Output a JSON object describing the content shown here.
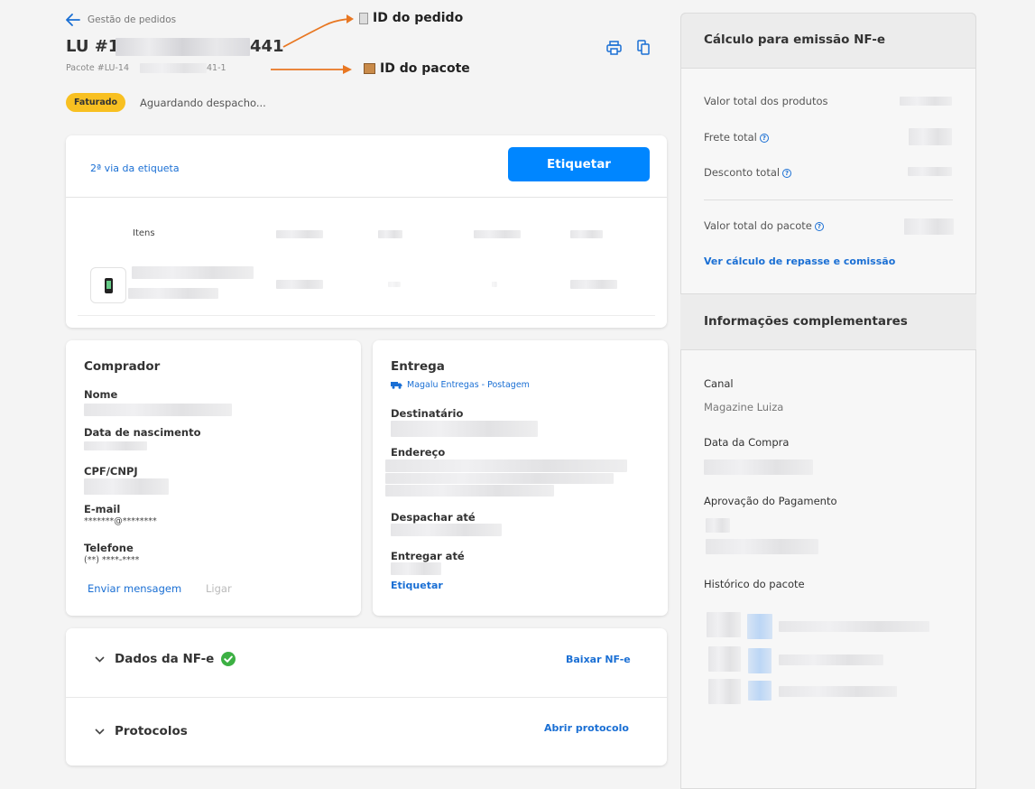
{
  "header": {
    "back_label": "Gestão de pedidos",
    "order_prefix": "LU #1",
    "order_suffix": "441",
    "package_prefix": "Pacote #LU-14",
    "package_suffix": "41-1",
    "status_badge": "Faturado",
    "status_text": "Aguardando despacho..."
  },
  "annotations": {
    "order_id": "ID do pedido",
    "package_id": "ID do pacote",
    "arrow_color": "#e87722"
  },
  "label_card": {
    "second_copy_link": "2ª via da etiqueta",
    "etiquetar_button": "Etiquetar",
    "items_header": "Itens"
  },
  "buyer": {
    "title": "Comprador",
    "name_label": "Nome",
    "birth_label": "Data de nascimento",
    "doc_label": "CPF/CNPJ",
    "email_label": "E-mail",
    "email_value": "*******@********",
    "phone_label": "Telefone",
    "phone_value": "(**) ****-****",
    "send_message": "Enviar mensagem",
    "call": "Ligar"
  },
  "delivery": {
    "title": "Entrega",
    "carrier": "Magalu Entregas - Postagem",
    "recipient_label": "Destinatário",
    "address_label": "Endereço",
    "ship_by_label": "Despachar até",
    "deliver_by_label": "Entregar até",
    "etiquetar_link": "Etiquetar"
  },
  "nfe": {
    "title": "Dados da NF-e",
    "download": "Baixar NF-e"
  },
  "protocols": {
    "title": "Protocolos",
    "open": "Abrir protocolo"
  },
  "sidebar": {
    "calc_title": "Cálculo para emissão NF-e",
    "total_products": "Valor total dos produtos",
    "freight_total": "Frete total",
    "discount_total": "Desconto total",
    "package_total": "Valor total do pacote",
    "commission_link": "Ver cálculo de repasse e comissão",
    "info_title": "Informações complementares",
    "channel_label": "Canal",
    "channel_value": "Magazine Luiza",
    "purchase_date_label": "Data da Compra",
    "payment_approval_label": "Aprovação do Pagamento",
    "history_label": "Histórico do pacote"
  },
  "colors": {
    "primary": "#0086ff",
    "link": "#1a6fd4",
    "badge": "#f8c021",
    "success": "#3cb043"
  }
}
